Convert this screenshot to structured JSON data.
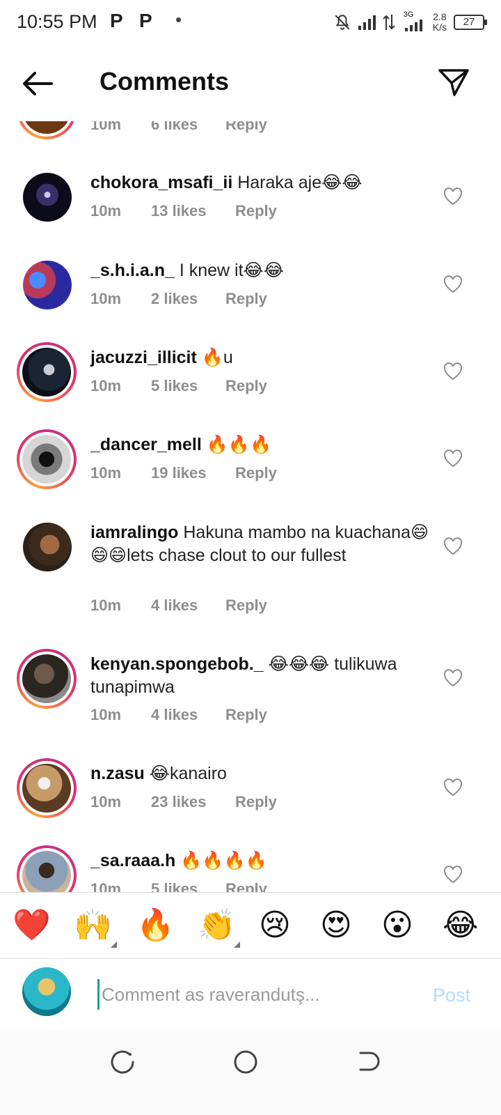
{
  "status_bar": {
    "time": "10:55 PM",
    "p_icon_label": "P",
    "dot": "•",
    "network_type": "3G",
    "speed_value": "2.8",
    "speed_unit": "K/s",
    "battery": "27"
  },
  "header": {
    "title": "Comments"
  },
  "partial_top": {
    "time": "10m",
    "likes": "6 likes",
    "reply": "Reply"
  },
  "comments": [
    {
      "username": "chokora_msafi_ii",
      "text": " Haraka aje😂😂",
      "time": "10m",
      "likes": "13 likes",
      "reply": "Reply"
    },
    {
      "username": "_s.h.i.a.n_",
      "text": " I knew it😂😂",
      "time": "10m",
      "likes": "2 likes",
      "reply": "Reply"
    },
    {
      "username": "jacuzzi_illicit",
      "text": " 🔥u",
      "time": "10m",
      "likes": "5 likes",
      "reply": "Reply"
    },
    {
      "username": "_dancer_mell",
      "text": " 🔥🔥🔥",
      "time": "10m",
      "likes": "19 likes",
      "reply": "Reply"
    },
    {
      "username": "iamralingo",
      "text": " Hakuna mambo na kuachana😄😄😄lets chase clout to our fullest",
      "time": "10m",
      "likes": "4 likes",
      "reply": "Reply"
    },
    {
      "username": "kenyan.spongebob._",
      "text": " 😂😂😂 tulikuwa tunapimwa",
      "time": "10m",
      "likes": "4 likes",
      "reply": "Reply"
    },
    {
      "username": "n.zasu",
      "text": " 😂kanairo",
      "time": "10m",
      "likes": "23 likes",
      "reply": "Reply"
    },
    {
      "username": "_sa.raaa.h",
      "text": " 🔥🔥🔥🔥",
      "time": "10m",
      "likes": "5 likes",
      "reply": "Reply"
    }
  ],
  "reactions": [
    "❤️",
    "🙌",
    "🔥",
    "👏",
    "😢",
    "😍",
    "😮",
    "😂"
  ],
  "composer": {
    "placeholder": "Comment as raverandutş...",
    "post_label": "Post"
  },
  "colors": {
    "muted_text": "#8e8e8e",
    "post_disabled": "#b3dbff",
    "story_ring_start": "#f9a23a",
    "story_ring_end": "#c13584"
  }
}
